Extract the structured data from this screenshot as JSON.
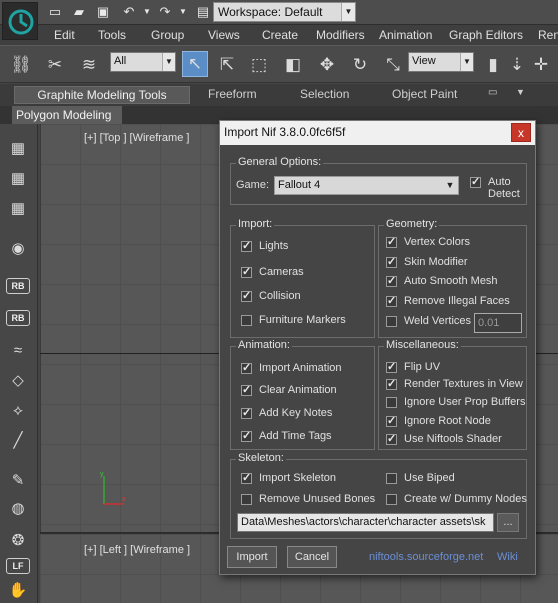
{
  "quick_access": {
    "workspace": "Workspace: Default"
  },
  "menu": {
    "items": [
      "Edit",
      "Tools",
      "Group",
      "Views",
      "Create",
      "Modifiers",
      "Animation",
      "Graph Editors",
      "Ren"
    ]
  },
  "toolbar": {
    "selection_filter": "All",
    "reference_coord": "View"
  },
  "ribbon": {
    "tabs": [
      "Graphite Modeling Tools",
      "Freeform",
      "Selection",
      "Object Paint"
    ],
    "subtab": "Polygon Modeling"
  },
  "viewports": {
    "top_label": "[+] [Top ] [Wireframe ]",
    "left_label": "[+] [Left ] [Wireframe ]"
  },
  "left_toolbar": {
    "badges": [
      "RB",
      "RB",
      "LF"
    ]
  },
  "dialog": {
    "title": "Import Nif 3.8.0.0fc6f5f",
    "close": "x",
    "general": {
      "title": "General Options:",
      "game_label": "Game:",
      "game_value": "Fallout 4",
      "auto_detect": "Auto Detect",
      "auto_detect_checked": true
    },
    "import": {
      "title": "Import:",
      "items": [
        {
          "label": "Lights",
          "checked": true
        },
        {
          "label": "Cameras",
          "checked": true
        },
        {
          "label": "Collision",
          "checked": true
        },
        {
          "label": "Furniture Markers",
          "checked": false
        }
      ]
    },
    "geometry": {
      "title": "Geometry:",
      "items": [
        {
          "label": "Vertex Colors",
          "checked": true
        },
        {
          "label": "Skin Modifier",
          "checked": true
        },
        {
          "label": "Auto Smooth Mesh",
          "checked": true
        },
        {
          "label": "Remove Illegal Faces",
          "checked": true
        },
        {
          "label": "Weld Vertices",
          "checked": false
        }
      ],
      "weld_value": "0.01"
    },
    "animation": {
      "title": "Animation:",
      "items": [
        {
          "label": "Import Animation",
          "checked": true
        },
        {
          "label": "Clear Animation",
          "checked": true
        },
        {
          "label": "Add Key Notes",
          "checked": true
        },
        {
          "label": "Add Time Tags",
          "checked": true
        }
      ]
    },
    "misc": {
      "title": "Miscellaneous:",
      "items": [
        {
          "label": "Flip UV",
          "checked": true
        },
        {
          "label": "Render Textures in View",
          "checked": true
        },
        {
          "label": "Ignore User Prop Buffers",
          "checked": false
        },
        {
          "label": "Ignore Root Node",
          "checked": true
        },
        {
          "label": "Use Niftools Shader",
          "checked": true
        }
      ]
    },
    "skeleton": {
      "title": "Skeleton:",
      "items": [
        {
          "label": "Import Skeleton",
          "checked": true
        },
        {
          "label": "Use Biped",
          "checked": false
        },
        {
          "label": "Remove Unused Bones",
          "checked": false
        },
        {
          "label": "Create w/ Dummy Nodes",
          "checked": false
        }
      ],
      "path": "Data\\Meshes\\actors\\character\\character assets\\sk",
      "browse": "..."
    },
    "import_button": "Import",
    "cancel_button": "Cancel",
    "link_site": "niftools.sourceforge.net",
    "link_wiki": "Wiki"
  }
}
